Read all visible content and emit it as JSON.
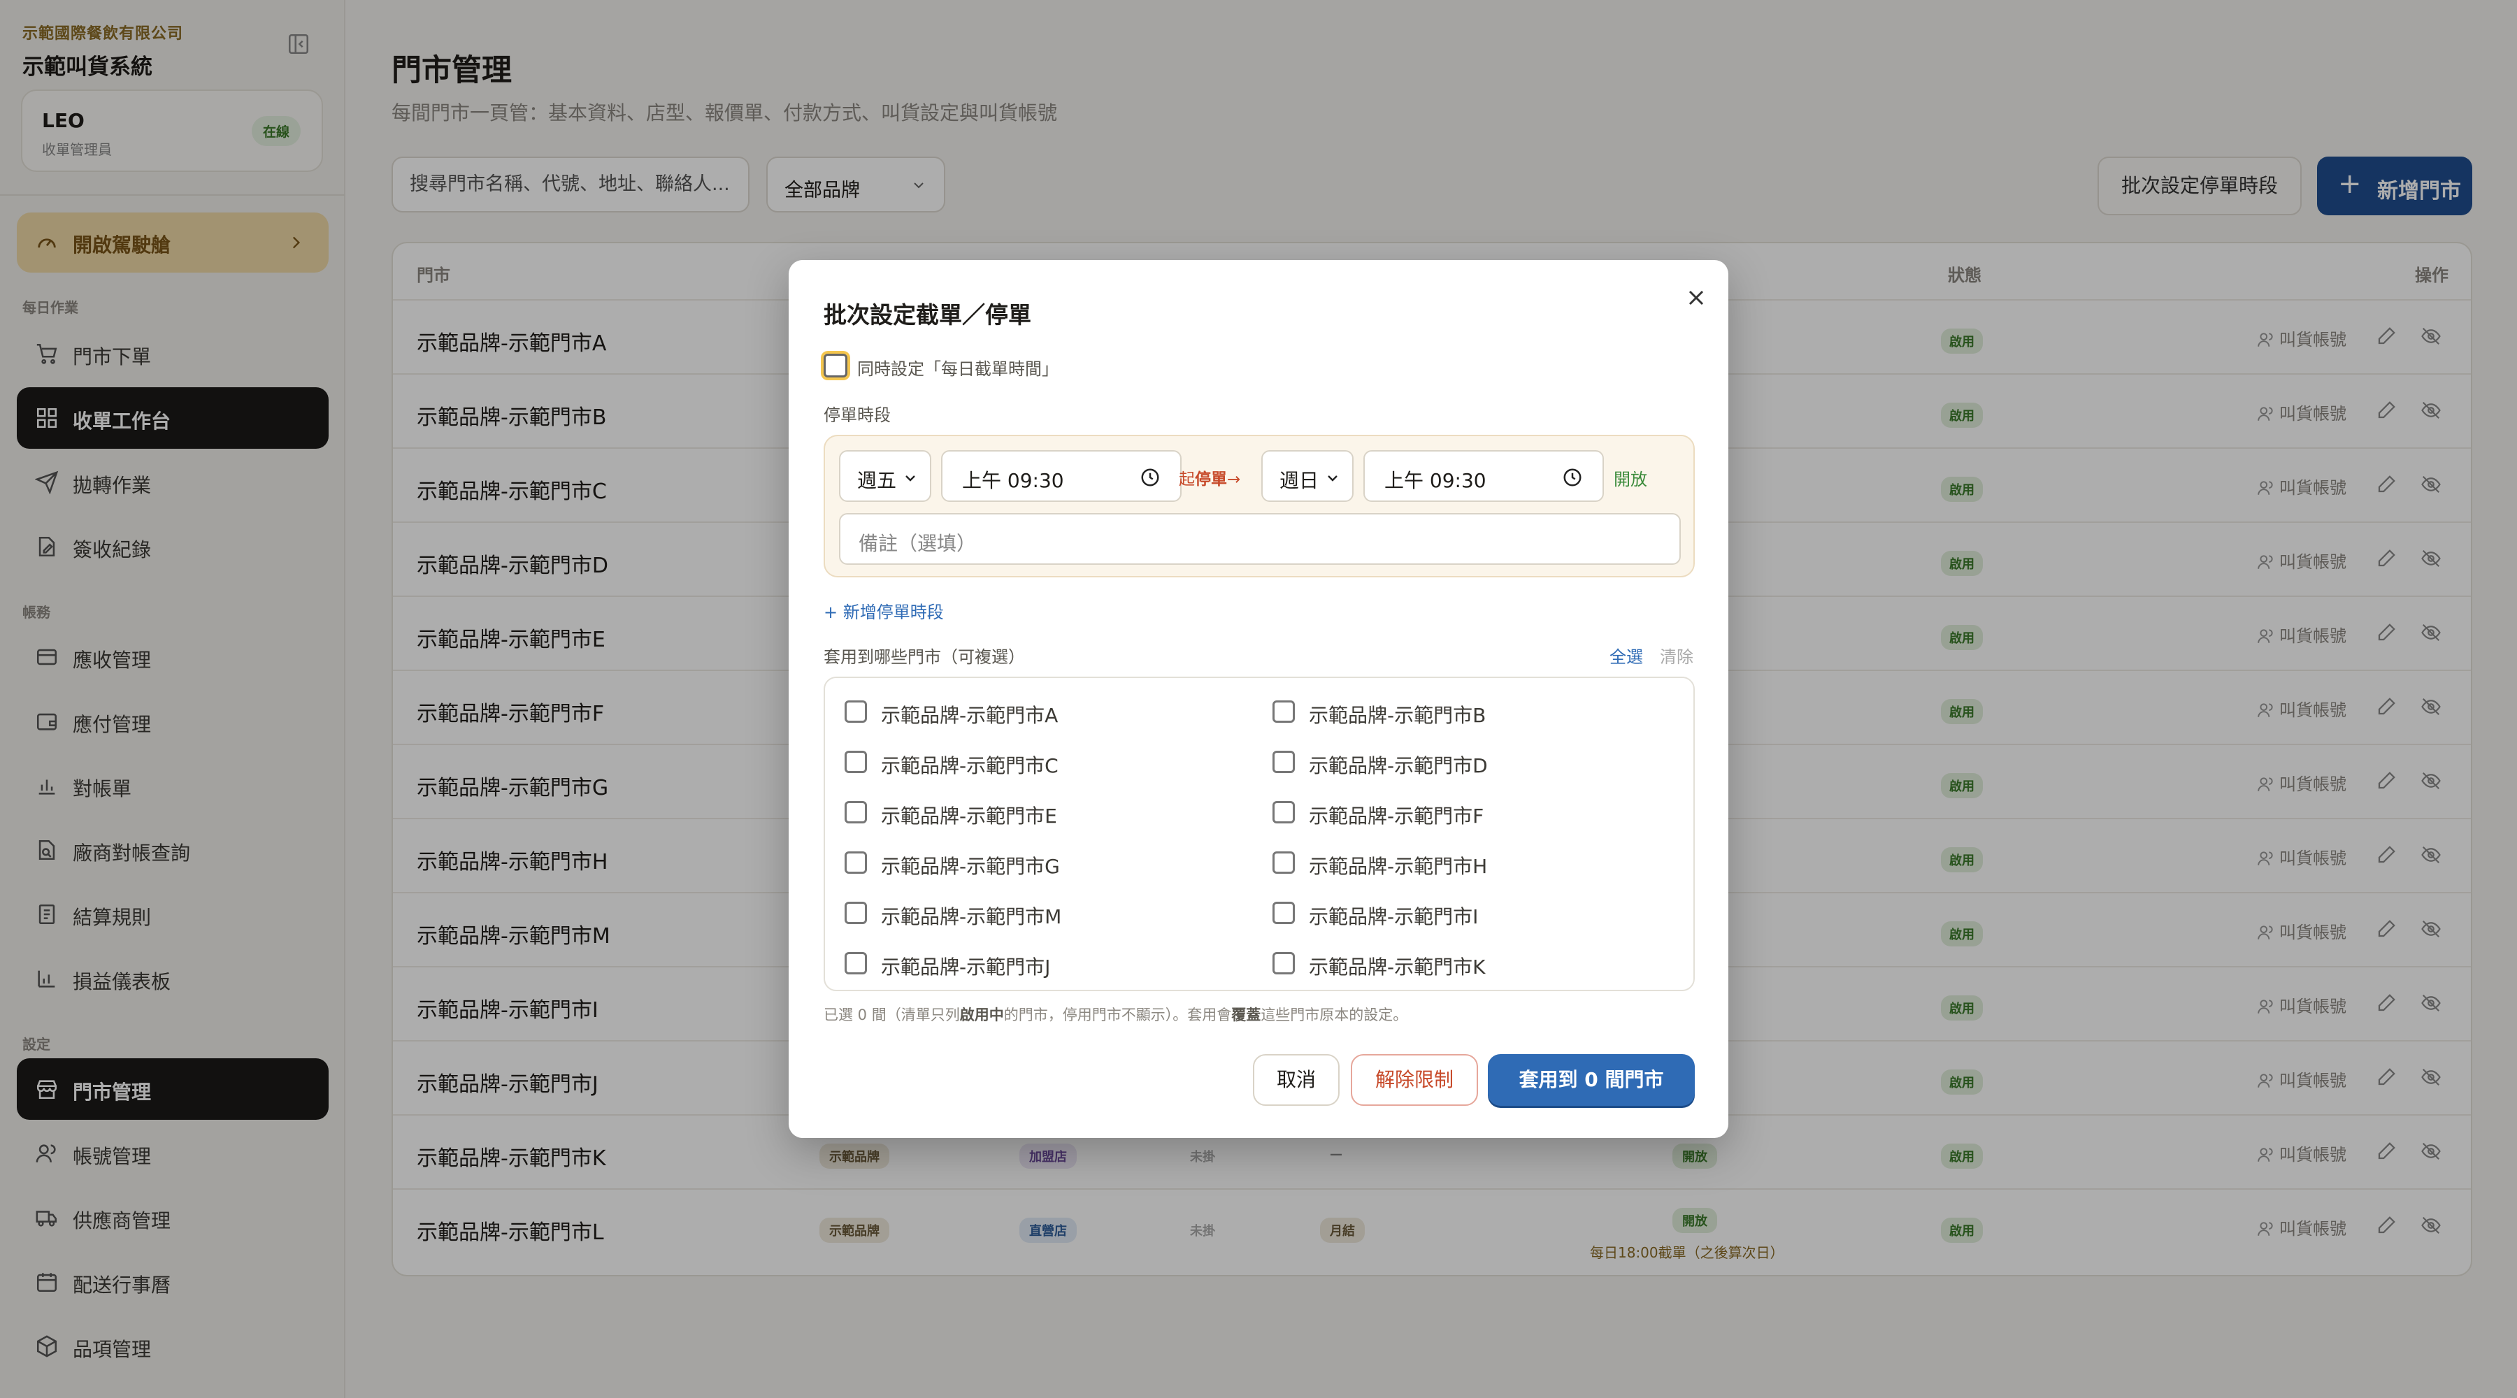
{
  "sidebar": {
    "company": "示範國際餐飲有限公司",
    "system": "示範叫貨系統",
    "user": {
      "name": "LEO",
      "role": "收單管理員",
      "status": "在線"
    },
    "cockpit": "開啟駕駛艙",
    "sections": {
      "daily": "每日作業",
      "accounts": "帳務",
      "settings": "設定"
    },
    "items": [
      {
        "label": "門市下單",
        "icon": "cart-icon"
      },
      {
        "label": "收單工作台",
        "icon": "grid-icon"
      },
      {
        "label": "拋轉作業",
        "icon": "send-icon"
      },
      {
        "label": "簽收紀錄",
        "icon": "doc-edit-icon"
      },
      {
        "label": "應收管理",
        "icon": "card-icon"
      },
      {
        "label": "應付管理",
        "icon": "wallet-icon"
      },
      {
        "label": "對帳單",
        "icon": "bar-chart-icon"
      },
      {
        "label": "廠商對帳查詢",
        "icon": "file-search-icon"
      },
      {
        "label": "結算規則",
        "icon": "receipt-icon"
      },
      {
        "label": "損益儀表板",
        "icon": "chart-icon"
      },
      {
        "label": "門市管理",
        "icon": "store-icon"
      },
      {
        "label": "帳號管理",
        "icon": "users-icon"
      },
      {
        "label": "供應商管理",
        "icon": "truck-icon"
      },
      {
        "label": "配送行事曆",
        "icon": "calendar-icon"
      },
      {
        "label": "品項管理",
        "icon": "box-icon"
      }
    ]
  },
  "page": {
    "title": "門市管理",
    "subtitle": "每間門市一頁管：基本資料、店型、報價單、付款方式、叫貨設定與叫貨帳號",
    "search_text": "搜尋門市名稱、代號、地址、聯絡人...",
    "brand_filter": "全部品牌",
    "batch_button": "批次設定停單時段",
    "add_button": "新增門市"
  },
  "table": {
    "headers": {
      "store": "門市",
      "status": "狀態",
      "actions": "操作"
    },
    "rows": [
      "示範品牌-示範門市A",
      "示範品牌-示範門市B",
      "示範品牌-示範門市C",
      "示範品牌-示範門市D",
      "示範品牌-示範門市E",
      "示範品牌-示範門市F",
      "示範品牌-示範門市G",
      "示範品牌-示範門市H",
      "示範品牌-示範門市M",
      "示範品牌-示範門市I",
      "示範品牌-示範門市J",
      "示範品牌-示範門市K",
      "示範品牌-示範門市L"
    ],
    "status_label": "啟用",
    "account_label": "叫貨帳號",
    "row_k": {
      "brand": "示範品牌",
      "type": "加盟店",
      "quote": "未掛",
      "pay": "—",
      "order": "開放"
    },
    "row_l": {
      "brand": "示範品牌",
      "type": "直營店",
      "quote": "未掛",
      "pay": "月結",
      "order": "開放",
      "cutoff": "每日18:00截單（之後算次日）"
    }
  },
  "modal": {
    "title": "批次設定截單／停單",
    "daily_checkbox": "同時設定「每日截單時間」",
    "period_label": "停單時段",
    "from_day": "週五",
    "from_time": "上午 09:30",
    "arrow_pre": "起",
    "arrow_key": "停單",
    "arrow_post": "→",
    "to_day": "週日",
    "to_time": "上午 09:30",
    "open_label": "開放",
    "note_placeholder": "備註（選填）",
    "add_period": "+ 新增停單時段",
    "apply_label": "套用到哪些門市（可複選）",
    "select_all": "全選",
    "clear": "清除",
    "stores": [
      "示範品牌-示範門市A",
      "示範品牌-示範門市B",
      "示範品牌-示範門市C",
      "示範品牌-示範門市D",
      "示範品牌-示範門市E",
      "示範品牌-示範門市F",
      "示範品牌-示範門市G",
      "示範品牌-示範門市H",
      "示範品牌-示範門市M",
      "示範品牌-示範門市I",
      "示範品牌-示範門市J",
      "示範品牌-示範門市K"
    ],
    "footnote_1": "已選 0 間（清單只列",
    "footnote_b1": "啟用中",
    "footnote_2": "的門市，停用門市不顯示）。套用會",
    "footnote_b2": "覆蓋",
    "footnote_3": "這些門市原本的設定。",
    "cancel": "取消",
    "unlimit": "解除限制",
    "apply": "套用到 0 間門市"
  },
  "colors": {
    "accent": "#2f6bb5",
    "primary_dark": "#1b1a18",
    "brand": "#1f4d8f",
    "danger": "#c74a2a",
    "success": "#3a7a2a"
  }
}
